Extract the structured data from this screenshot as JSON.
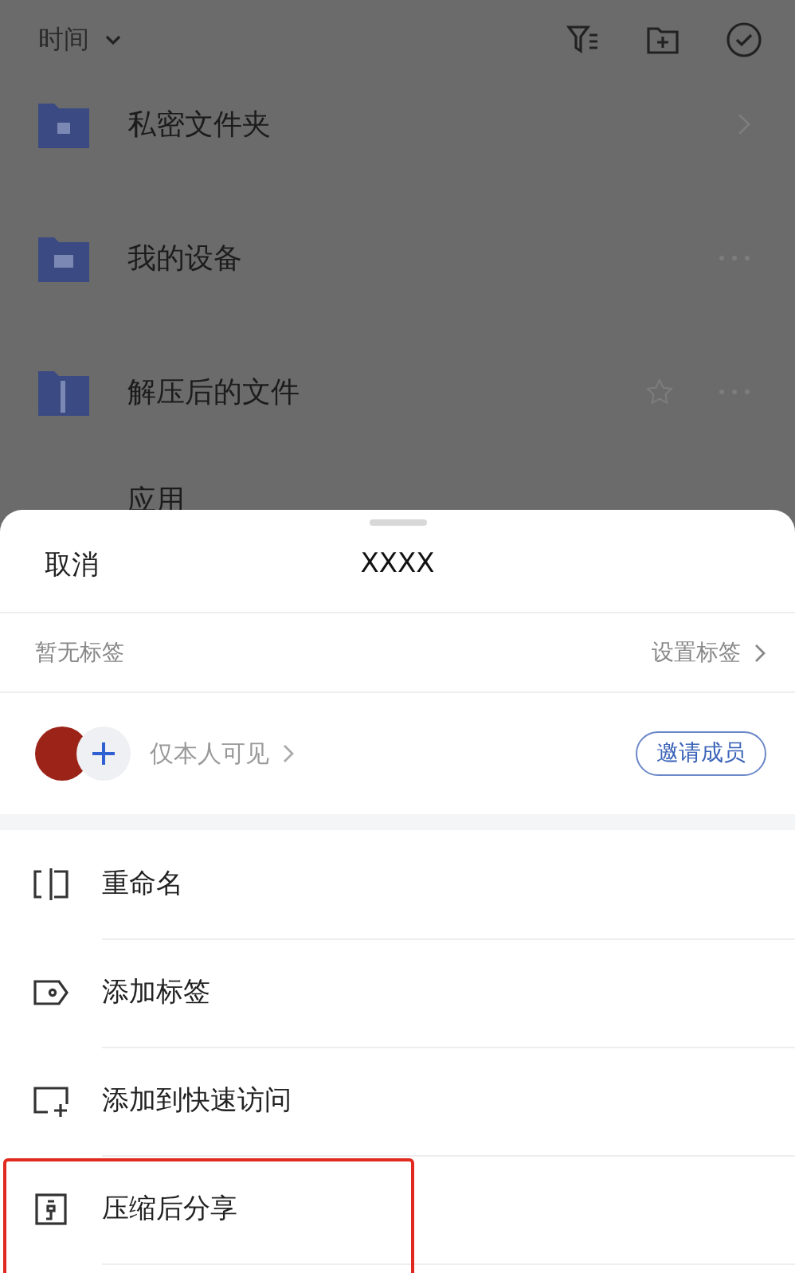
{
  "toolbar": {
    "sort_label": "时间"
  },
  "folders": [
    {
      "name": "私密文件夹",
      "kind": "lock",
      "chevron": true
    },
    {
      "name": "我的设备",
      "kind": "device",
      "more": true
    },
    {
      "name": "解压后的文件",
      "kind": "zip",
      "star": true,
      "more": true
    },
    {
      "name": "应用",
      "kind": "plain"
    }
  ],
  "sheet": {
    "cancel": "取消",
    "title": "XXXX",
    "tags_empty": "暂无标签",
    "set_tags": "设置标签",
    "visibility": "仅本人可见",
    "invite": "邀请成员",
    "actions": [
      {
        "label": "重命名",
        "kind": "rename",
        "highlighted": false
      },
      {
        "label": "添加标签",
        "kind": "tag",
        "highlighted": false
      },
      {
        "label": "添加到快速访问",
        "kind": "quick",
        "highlighted": false
      },
      {
        "label": "压缩后分享",
        "kind": "zip-share",
        "highlighted": true
      }
    ]
  }
}
